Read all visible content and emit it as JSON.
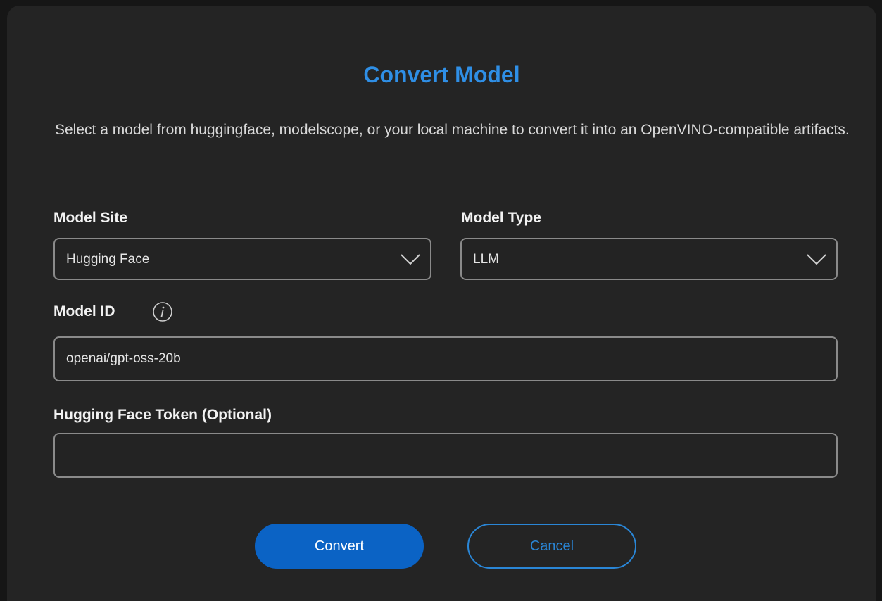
{
  "dialog": {
    "title": "Convert Model",
    "description": "Select a model from huggingface, modelscope, or your local machine to convert it into an OpenVINO-compatible artifacts."
  },
  "model_site": {
    "label": "Model Site",
    "selected": "Hugging Face"
  },
  "model_type": {
    "label": "Model Type",
    "selected": "LLM"
  },
  "model_id": {
    "label": "Model ID",
    "value": "openai/gpt-oss-20b",
    "icon": "info-icon"
  },
  "hf_token": {
    "label": "Hugging Face Token (Optional)",
    "value": ""
  },
  "actions": {
    "convert_label": "Convert",
    "cancel_label": "Cancel"
  },
  "colors": {
    "accent": "#2f8fe6",
    "primary_button": "#0b63c5",
    "dialog_bg": "#242424"
  }
}
